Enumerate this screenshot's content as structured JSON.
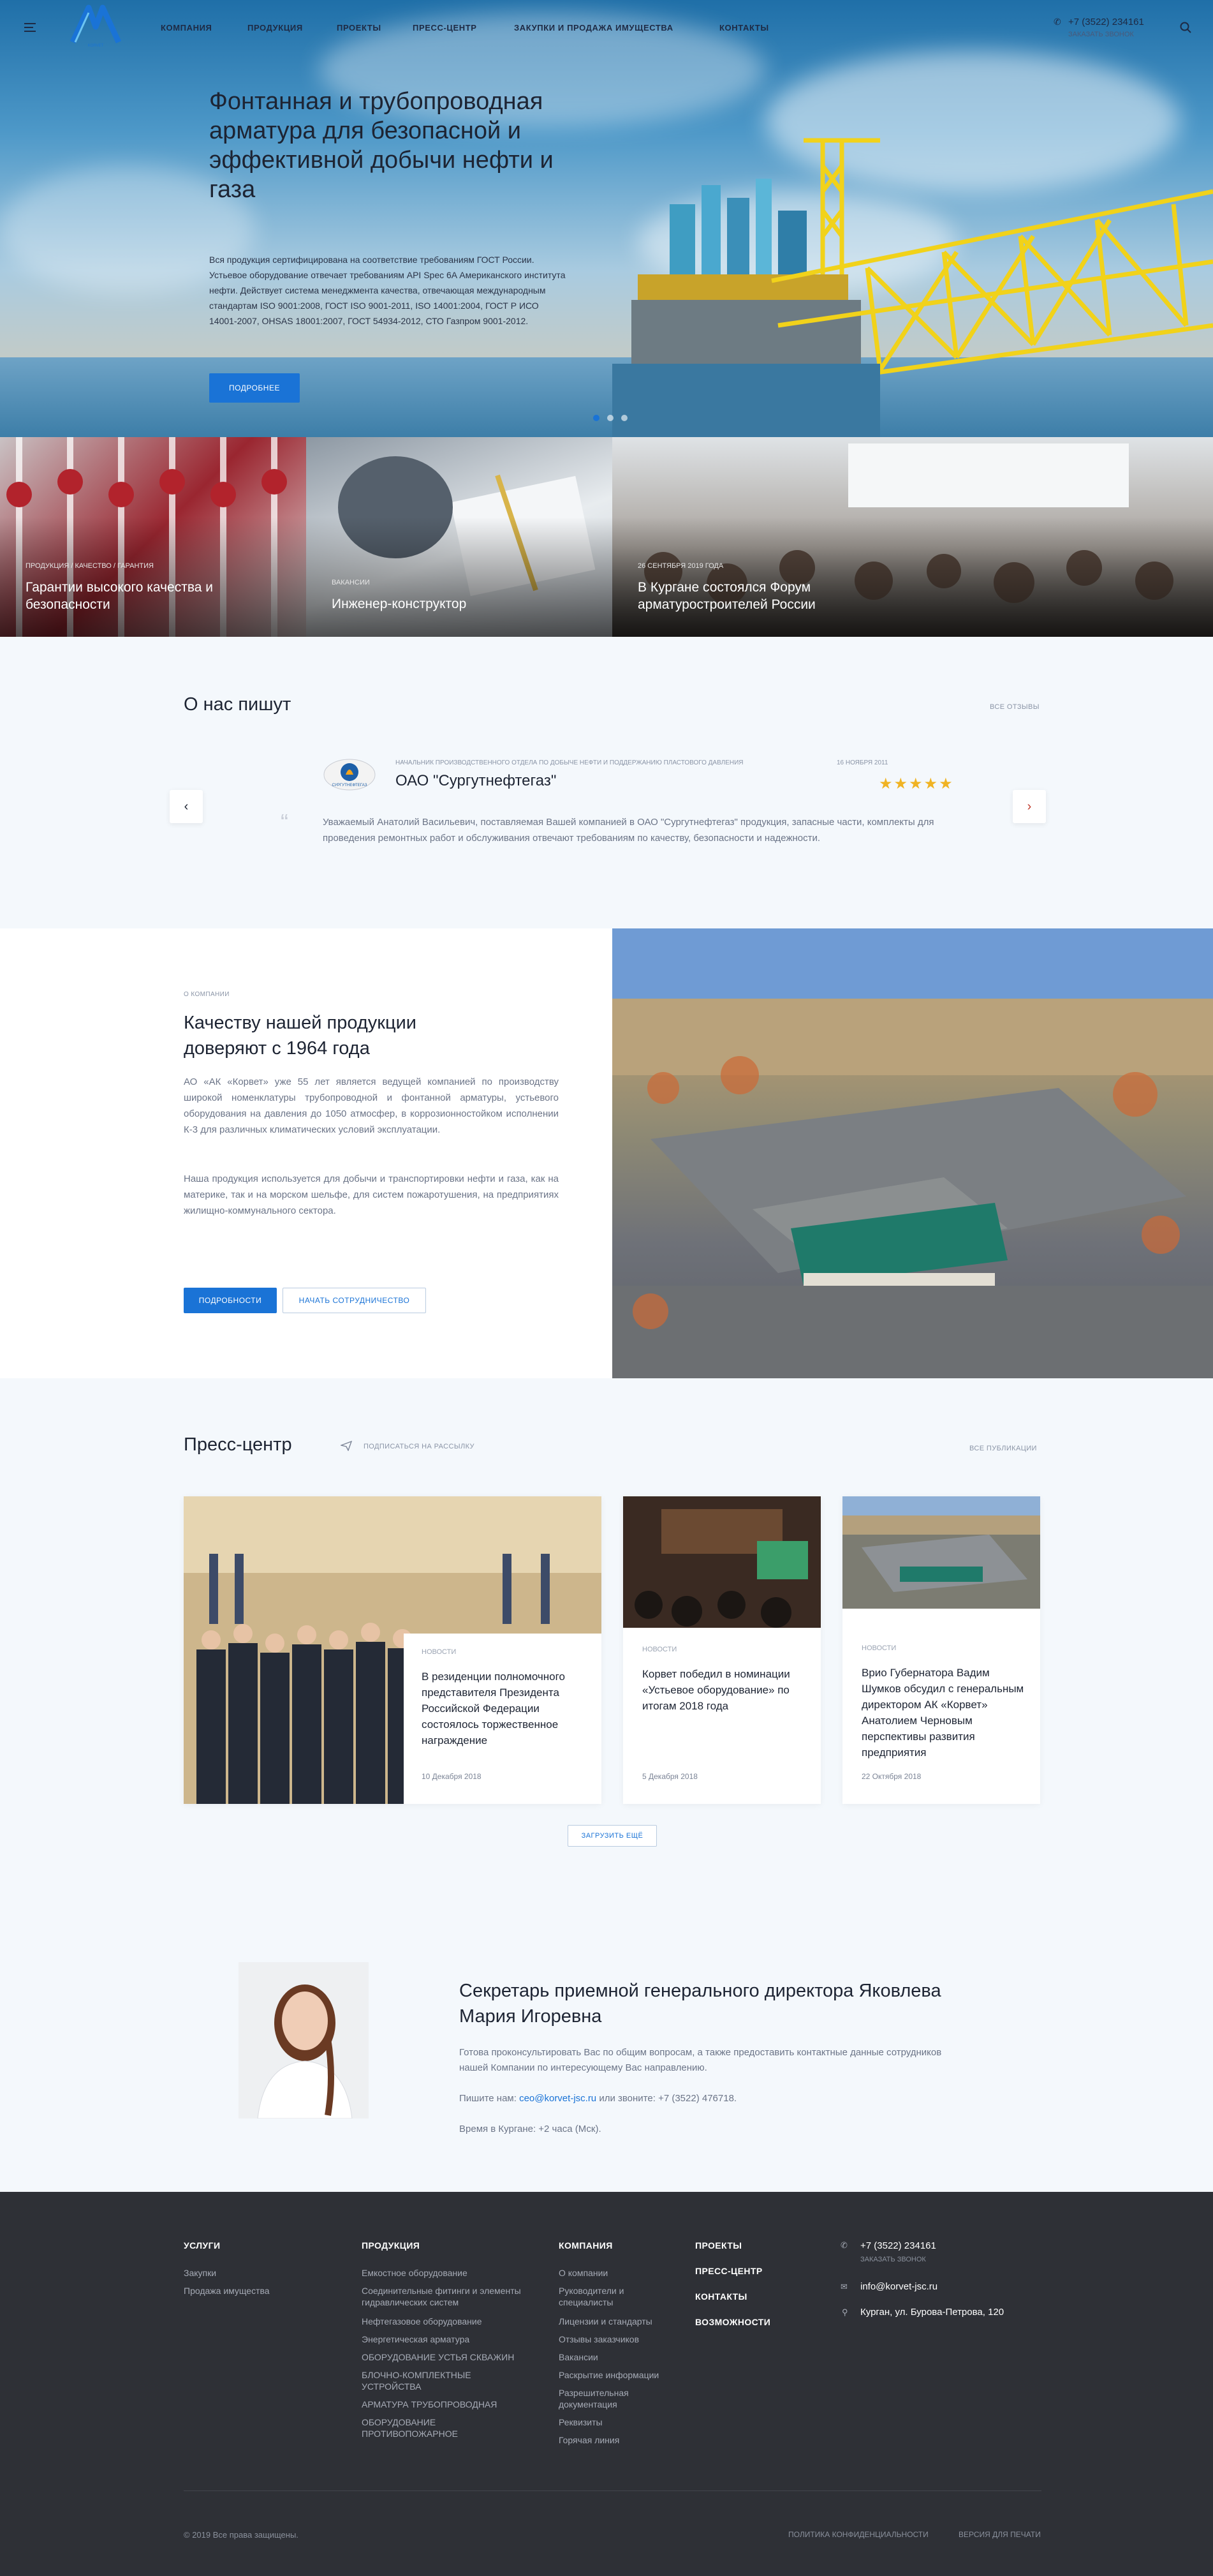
{
  "header": {
    "phone": "+7 (3522) 234161",
    "callback": "Заказать звонок",
    "nav": [
      "Компания",
      "Продукция",
      "Проекты",
      "Пресс-центр",
      "Закупки и продажа имущества",
      "Контакты"
    ]
  },
  "hero": {
    "title": "Фонтанная и трубопроводная арматура для безопасной и эффективной добычи нефти и газа",
    "text": "Вся продукция сертифицирована на соответствие требованиям ГОСТ России. Устьевое оборудование отвечает требованиям API Spec 6A Американского института нефти. Действует система менеджмента качества, отвечающая международным стандартам ISO 9001:2008, ГОСТ ISO 9001-2011, ISO 14001:2004, ГОСТ Р ИСО 14001-2007, OHSAS 18001:2007, ГОСТ 54934-2012, СТО Газпром 9001-2012.",
    "button": "Подробнее"
  },
  "tiles": [
    {
      "cat": "Продукция / Качество / Гарантия",
      "title": "Гарантии высокого качества и безопасности"
    },
    {
      "cat": "Вакансии",
      "title": "Инженер-конструктор"
    },
    {
      "cat": "26 сентября 2019 года",
      "title": "В Кургане состоялся Форум арматуростроителей России"
    }
  ],
  "reviews": {
    "title": "О нас пишут",
    "all": "Все отзывы",
    "meta": "Начальник производственного отдела по добыче нефти и поддержанию пластового давления",
    "date": "16 ноября 2011",
    "company": "ОАО \"Сургутнефтегаз\"",
    "logo_text": "СУРГУТНЕФТЕГАЗ",
    "text": "Уважаемый Анатолий Васильевич, поставляемая Вашей компанией в ОАО \"Сургутнефтегаз\" продукция, запасные части, комплекты для проведения ремонтных работ и обслуживания отвечают требованиям по качеству, безопасности и надежности.",
    "stars": "★★★★★",
    "quote": "“"
  },
  "about": {
    "cat": "О компании",
    "title": "Качеству нашей продукции доверяют с 1964 года",
    "p1": "АО «АК «Корвет» уже 55 лет является ведущей компанией по производству широкой номенклатуры трубопроводной и фонтанной арматуры, устьевого оборудования на давления до 1050 атмосфер, в коррозионностойком исполнении К-3 для различных климатических условий эксплуатации.",
    "p2": "Наша продукция используется для добычи и транспортировки нефти и газа, как на материке, так и на морском шельфе, для систем пожаротушения, на предприятиях жилищно-коммунального сектора.",
    "btn1": "Подробности",
    "btn2": "Начать сотрудничество"
  },
  "press": {
    "title": "Пресс-центр",
    "subscribe": "Подписаться на рассылку",
    "all": "Все публикации",
    "load_more": "Загрузить ещё",
    "cards": [
      {
        "cat": "Новости",
        "title": "В резиденции полномочного представителя Президента Российской Федерации состоялось торжественное награждение",
        "date": "10 Декабря 2018"
      },
      {
        "cat": "Новости",
        "title": "Корвет победил в номинации «Устьевое оборудование» по итогам 2018 года",
        "date": "5 Декабря 2018"
      },
      {
        "cat": "Новости",
        "title": "Врио Губернатора Вадим Шумков обсудил с генеральным директором АК «Корвет» Анатолием Черновым перспективы развития предприятия",
        "date": "22 Октября 2018"
      }
    ]
  },
  "person": {
    "title": "Секретарь приемной генерального директора Яковлева Мария Игоревна",
    "text": "Готова проконсультировать Вас по общим вопросам, а также предоставить контактные данные сотрудников нашей Компании по интересующему Вас направлению.",
    "write": "Пишите нам:",
    "email": "ceo@korvet-jsc.ru",
    "call": "или звоните: +7 (3522) 476718.",
    "time": "Время в Кургане: +2 часа (Мск)."
  },
  "footer": {
    "col1": {
      "title": "Услуги",
      "items": [
        "Закупки",
        "Продажа имущества"
      ]
    },
    "col2": {
      "title": "Продукция",
      "items": [
        "Емкостное оборудование",
        "Соединительные фитинги и элементы гидравлических систем",
        "Нефтегазовое оборудование",
        "Энергетическая арматура",
        "ОБОРУДОВАНИЕ УСТЬЯ СКВАЖИН",
        "БЛОЧНО-КОМПЛЕКТНЫЕ УСТРОЙСТВА",
        "АРМАТУРА ТРУБОПРОВОДНАЯ",
        "ОБОРУДОВАНИЕ ПРОТИВОПОЖАРНОЕ"
      ]
    },
    "col3": {
      "title": "Компания",
      "items": [
        "О компании",
        "Руководители и специалисты",
        "Лицензии и стандарты",
        "Отзывы заказчиков",
        "Вакансии",
        "Раскрытие информации",
        "Разрешительная документация",
        "Реквизиты",
        "Горячая линия"
      ]
    },
    "col4": [
      "Проекты",
      "Пресс-центр",
      "Контакты",
      "Возможности"
    ],
    "phone": "+7 (3522) 234161",
    "callback": "Заказать звонок",
    "email": "info@korvet-jsc.ru",
    "address": "Курган, ул. Бурова-Петрова, 120",
    "copyright": "© 2019 Все права защищены.",
    "privacy": "Политика конфиденциальности",
    "print": "Версия для печати"
  }
}
